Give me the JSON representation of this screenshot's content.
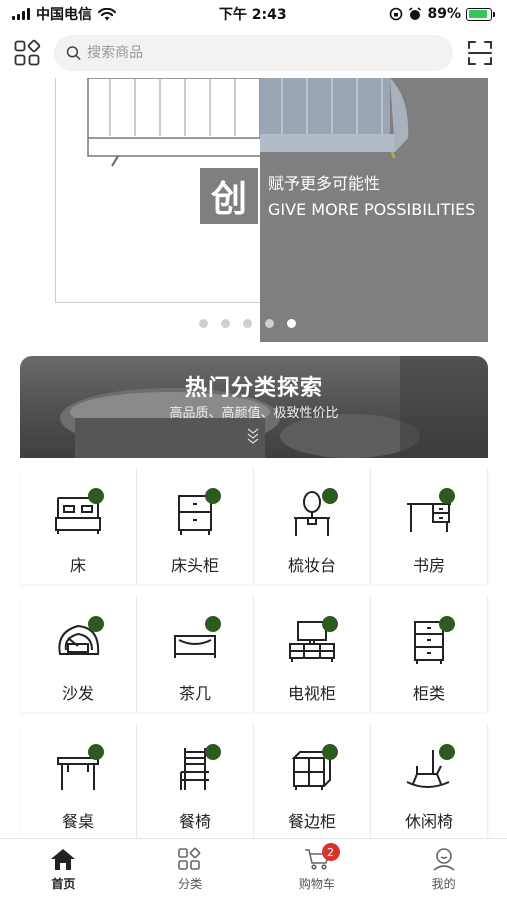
{
  "status_bar": {
    "carrier": "中国电信",
    "time": "下午 2:43",
    "battery_percent": "89%",
    "battery_level": 0.89
  },
  "top_bar": {
    "search_placeholder": "搜索商品"
  },
  "banner": {
    "char": "创",
    "tagline_cn": "赋予更多可能性",
    "tagline_en": "GIVE MORE POSSIBILITIES",
    "slide_count": 5,
    "active_slide": 5
  },
  "hot_section": {
    "title": "热门分类探索",
    "subtitle": "高品质、高颜值、极致性价比"
  },
  "categories": [
    {
      "label": "床",
      "icon": "bed-icon"
    },
    {
      "label": "床头柜",
      "icon": "nightstand-icon"
    },
    {
      "label": "梳妆台",
      "icon": "dresser-icon"
    },
    {
      "label": "书房",
      "icon": "desk-icon"
    },
    {
      "label": "沙发",
      "icon": "sofa-icon"
    },
    {
      "label": "茶几",
      "icon": "coffee-table-icon"
    },
    {
      "label": "电视柜",
      "icon": "tv-cabinet-icon"
    },
    {
      "label": "柜类",
      "icon": "cabinet-icon"
    },
    {
      "label": "餐桌",
      "icon": "dining-table-icon"
    },
    {
      "label": "餐椅",
      "icon": "dining-chair-icon"
    },
    {
      "label": "餐边柜",
      "icon": "sideboard-icon"
    },
    {
      "label": "休闲椅",
      "icon": "rocking-chair-icon"
    }
  ],
  "tabbar": {
    "home": "首页",
    "category": "分类",
    "cart": "购物车",
    "cart_count": "2",
    "mine": "我的"
  },
  "colors": {
    "accent_badge": "#2d5a1e",
    "banner_grey": "#7f7f7f",
    "cart_badge": "#d9342b"
  }
}
